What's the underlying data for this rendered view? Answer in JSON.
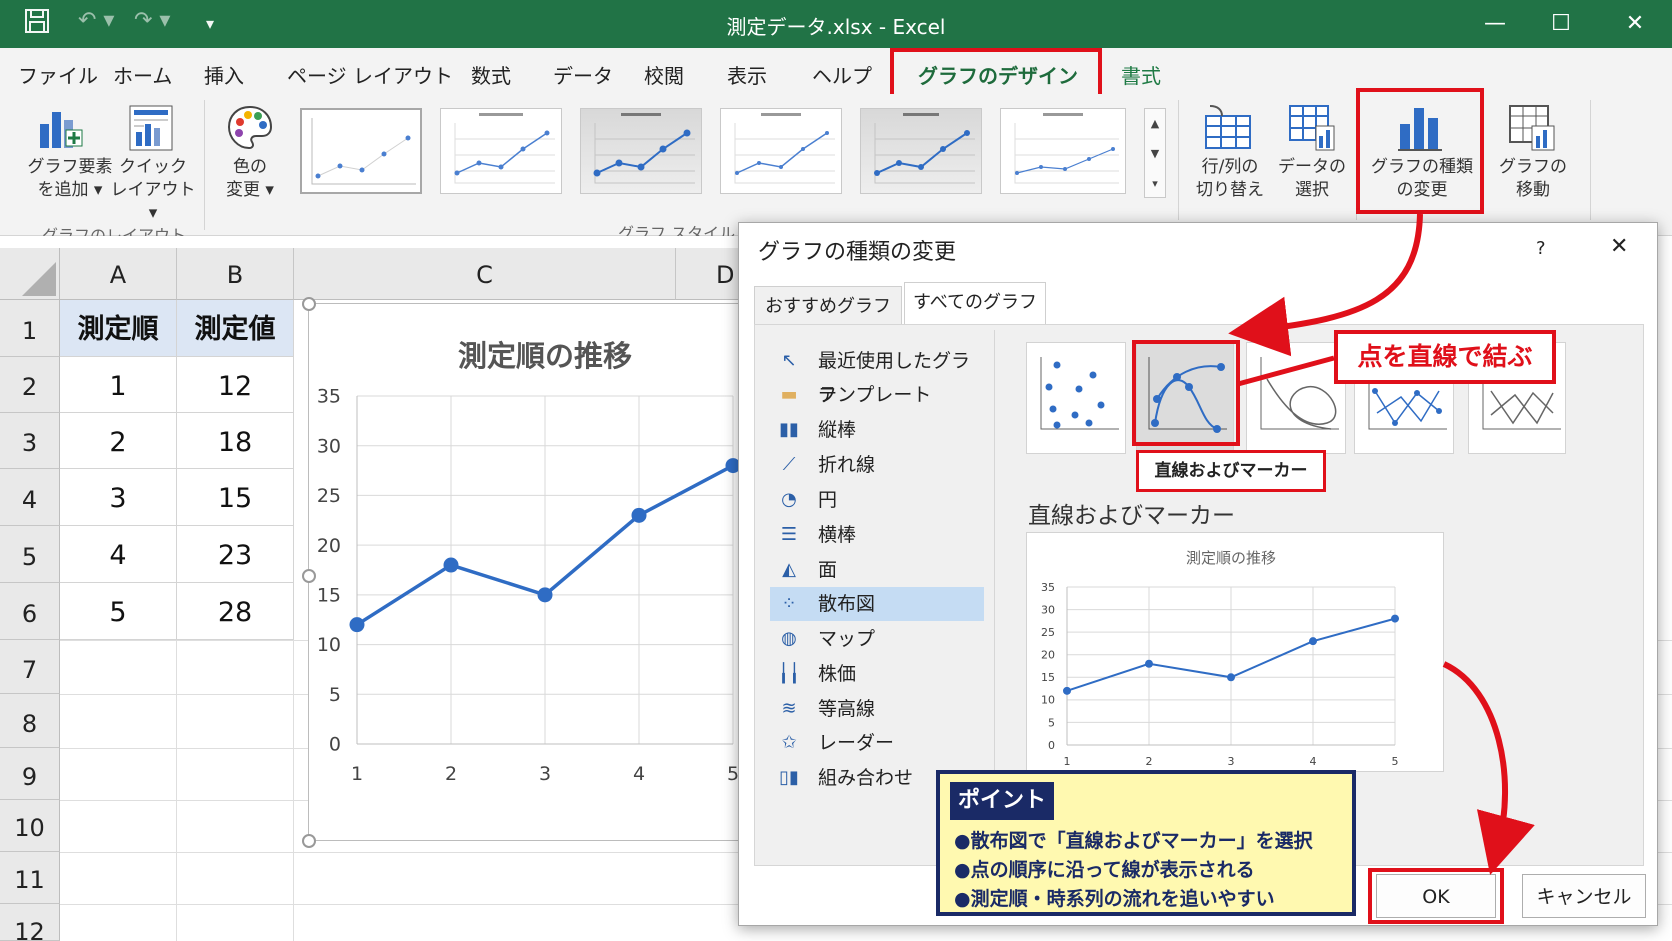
{
  "window": {
    "title": "測定データ.xlsx  -  Excel"
  },
  "menu": {
    "items": [
      "ファイル",
      "ホーム",
      "挿入",
      "ページ レイアウト",
      "数式",
      "データ",
      "校閲",
      "表示",
      "ヘルプ"
    ],
    "chart_design": "グラフのデザイン",
    "format": "書式"
  },
  "ribbon": {
    "add_element": "グラフ要素\nを追加 ▾",
    "quick_layout": "クイック\nレイアウト ▾",
    "change_colors": "色の\n変更 ▾",
    "group_layout": "グラフのレイアウト",
    "group_styles": "グラフ スタイル",
    "switch_row_col": "行/列の\n切り替え",
    "select_data": "データの\n選択",
    "change_type": "グラフの種類\nの変更",
    "move_chart": "グラフの\n移動"
  },
  "sheet": {
    "columns": [
      "A",
      "B",
      "C",
      "D"
    ],
    "rows": [
      "1",
      "2",
      "3",
      "4",
      "5",
      "6",
      "7",
      "8",
      "9",
      "10",
      "11",
      "12"
    ],
    "headers": [
      "測定順",
      "測定値"
    ],
    "data": [
      [
        "1",
        "12"
      ],
      [
        "2",
        "18"
      ],
      [
        "3",
        "15"
      ],
      [
        "4",
        "23"
      ],
      [
        "5",
        "28"
      ]
    ]
  },
  "chart_data": [
    {
      "type": "scatter",
      "title": "測定順の推移",
      "x": [
        1,
        2,
        3,
        4,
        5
      ],
      "series": [
        {
          "values": [
            12,
            18,
            15,
            23,
            28
          ]
        }
      ],
      "xlim": [
        1,
        5
      ],
      "ylim": [
        0,
        35
      ],
      "yticks": [
        0,
        5,
        10,
        15,
        20,
        25,
        30,
        35
      ],
      "xticks": [
        1,
        2,
        3,
        4,
        5
      ],
      "grid": true,
      "color": "#2f6cc4"
    },
    {
      "type": "scatter",
      "title": "測定順の推移",
      "x": [
        1,
        2,
        3,
        4,
        5
      ],
      "series": [
        {
          "values": [
            12,
            18,
            15,
            23,
            28
          ]
        }
      ],
      "ylim": [
        0,
        35
      ],
      "yticks": [
        0,
        5,
        10,
        15,
        20,
        25,
        30,
        35
      ],
      "xticks": [
        1,
        2,
        3,
        4,
        5
      ],
      "grid": true,
      "color": "#2f6cc4"
    }
  ],
  "dialog": {
    "title": "グラフの種類の変更",
    "help": "?",
    "close": "✕",
    "tabs": [
      "おすすめグラフ",
      "すべてのグラフ"
    ],
    "categories": [
      "最近使用したグラフ",
      "テンプレート",
      "縦棒",
      "折れ線",
      "円",
      "横棒",
      "面",
      "散布図",
      "マップ",
      "株価",
      "等高線",
      "レーダー",
      "組み合わせ"
    ],
    "selected_category": "散布図",
    "subtype_tooltip": "直線およびマーカー",
    "preview_heading": "直線およびマーカー",
    "ok": "OK",
    "cancel": "キャンセル"
  },
  "annotations": {
    "callout": "点を直線で結ぶ",
    "point_title": "ポイント",
    "points": [
      "●散布図で「直線およびマーカー」を選択",
      "●点の順序に沿って線が表示される",
      "●測定順・時系列の流れを追いやすい"
    ]
  },
  "colors": {
    "excel_green": "#217346",
    "highlight_red": "#e0101a",
    "series_blue": "#2f6cc4",
    "point_bg": "#fff9b0",
    "point_navy": "#1a2a66"
  }
}
